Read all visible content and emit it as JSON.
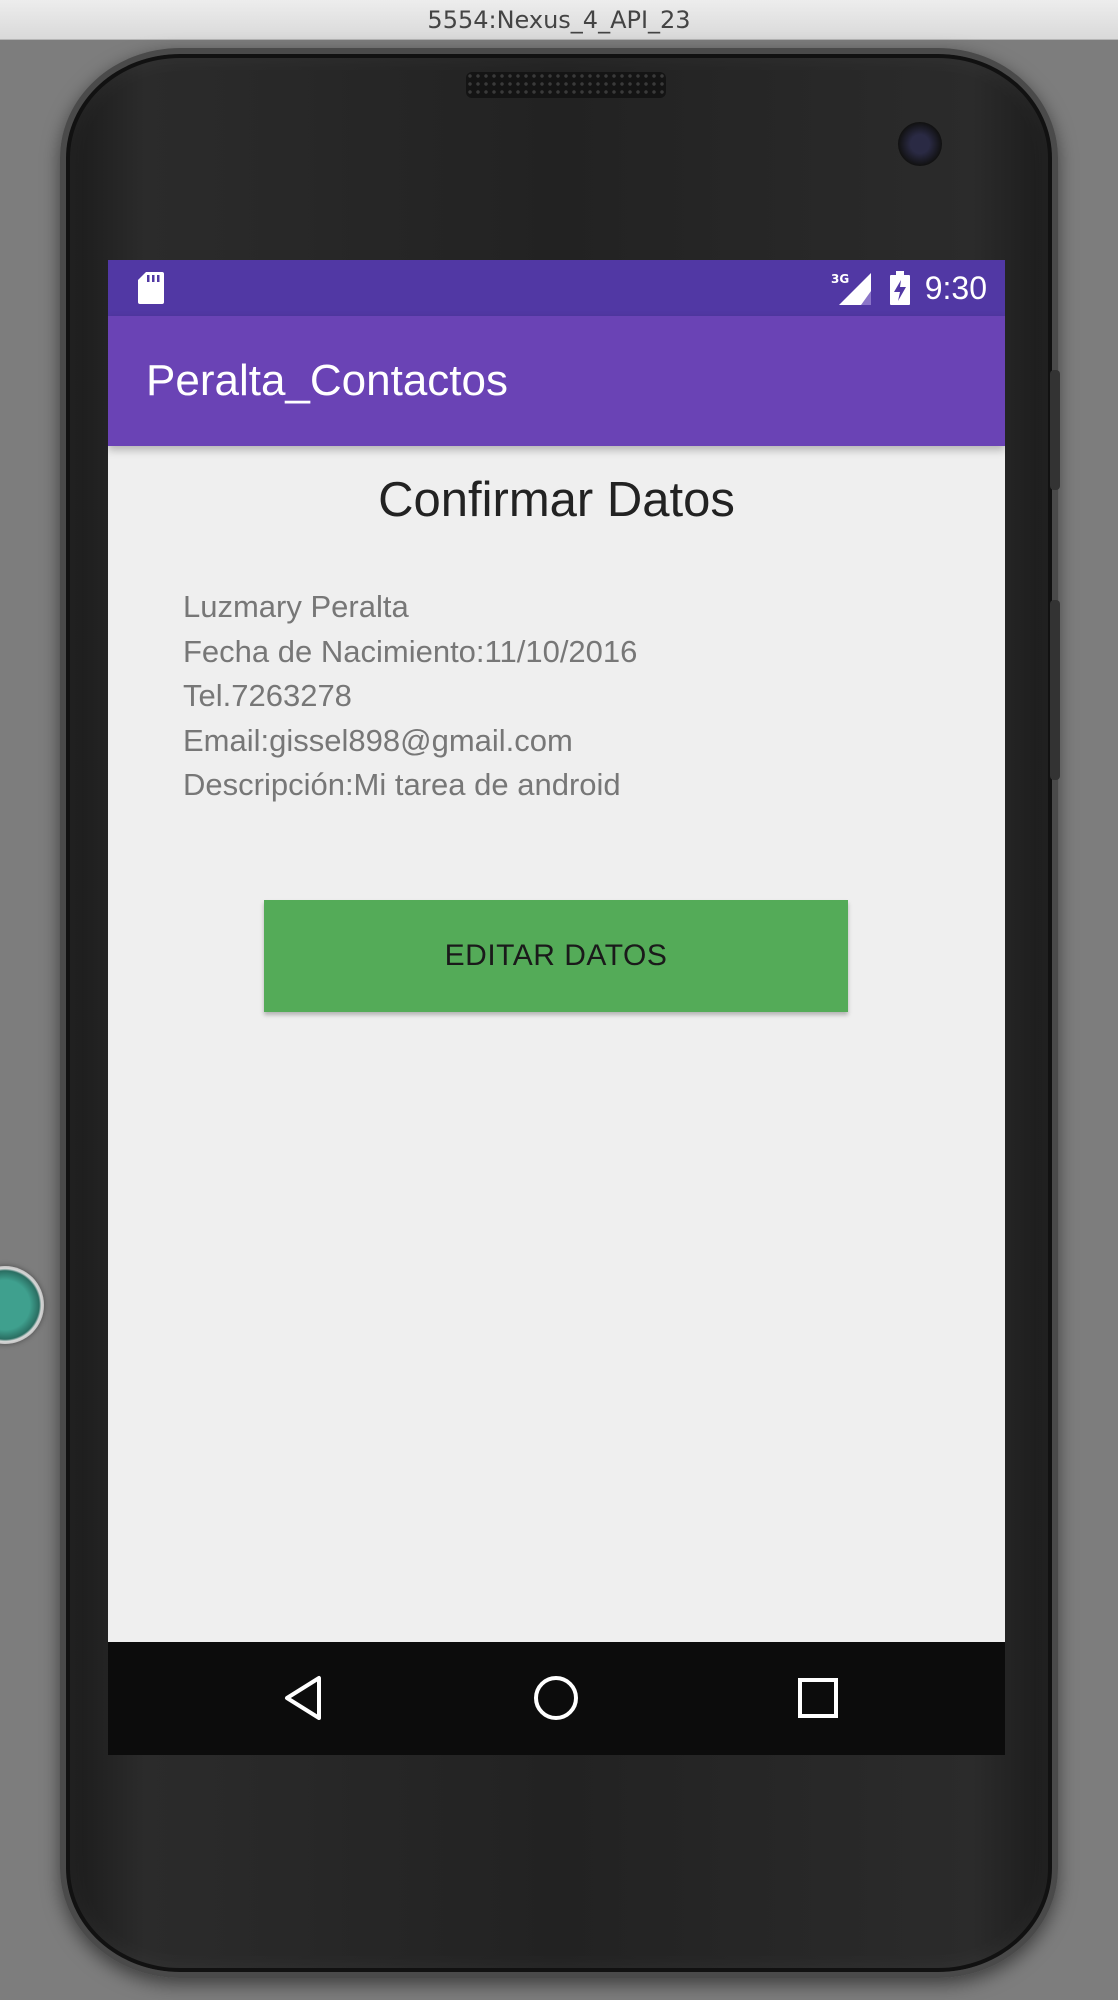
{
  "window": {
    "title": "5554:Nexus_4_API_23"
  },
  "status_bar": {
    "time": "9:30",
    "network": "3G",
    "icons": [
      "sd-card-icon",
      "signal-3g-icon",
      "battery-charging-icon"
    ]
  },
  "app_bar": {
    "title": "Peralta_Contactos"
  },
  "main": {
    "heading": "Confirmar Datos",
    "details": [
      "Luzmary Peralta",
      "Fecha de Nacimiento:11/10/2016",
      "Tel.7263278",
      "Email:gissel898@gmail.com",
      "Descripción:Mi tarea de android"
    ],
    "edit_button_label": "EDITAR DATOS"
  },
  "nav_bar": {
    "icons": [
      "back-icon",
      "home-icon",
      "recents-icon"
    ]
  },
  "colors": {
    "status_bar": "#5138a4",
    "app_bar": "#6a43b5",
    "button": "#54ab58",
    "background": "#efefef"
  }
}
